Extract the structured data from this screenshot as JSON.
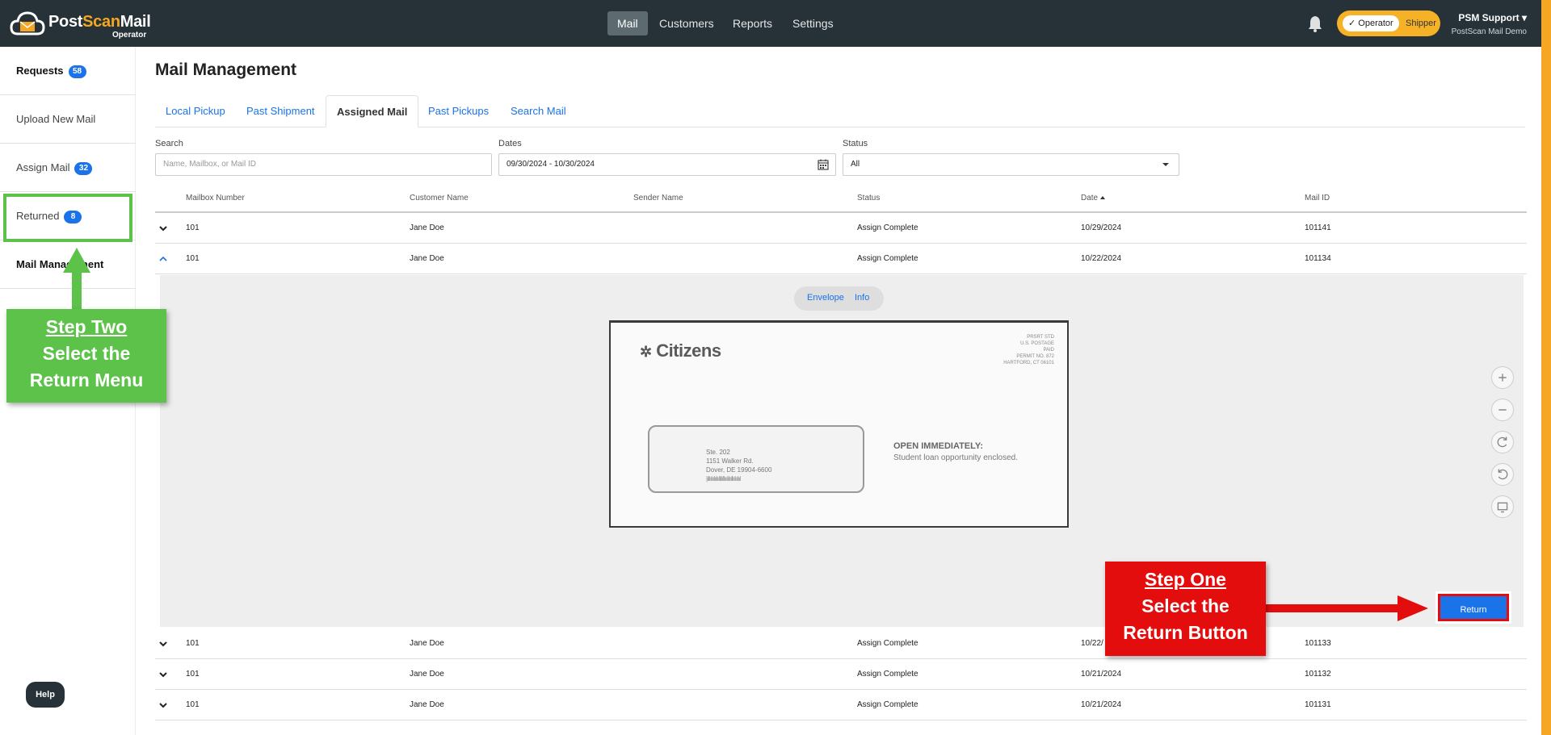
{
  "app": {
    "brand_part1": "Post",
    "brand_part2": "Scan",
    "brand_part3": "Mail",
    "brand_sub": "Operator",
    "nav": [
      "Mail",
      "Customers",
      "Reports",
      "Settings"
    ],
    "active_nav": "Mail",
    "roles": [
      "Operator",
      "Shipper"
    ],
    "user_name": "PSM Support",
    "user_org": "PostScan Mail Demo"
  },
  "sidebar": {
    "items": [
      {
        "label": "Requests",
        "badge": "58"
      },
      {
        "label": "Upload New Mail",
        "badge": ""
      },
      {
        "label": "Assign Mail",
        "badge": "32"
      },
      {
        "label": "Returned",
        "badge": "8"
      },
      {
        "label": "Mail Management",
        "badge": ""
      }
    ],
    "help_label": "Help"
  },
  "page": {
    "title": "Mail Management",
    "tabs": [
      "Local Pickup",
      "Past Shipment",
      "Assigned Mail",
      "Past Pickups",
      "Search Mail"
    ],
    "active_tab": "Assigned Mail"
  },
  "filters": {
    "search_label": "Search",
    "search_placeholder": "Name, Mailbox, or Mail ID",
    "dates_label": "Dates",
    "dates_value": "09/30/2024 - 10/30/2024",
    "status_label": "Status",
    "status_value": "All"
  },
  "table": {
    "columns": [
      "Mailbox Number",
      "Customer Name",
      "Sender Name",
      "Status",
      "Date",
      "Mail ID"
    ],
    "rows": [
      {
        "mailbox": "101",
        "customer": "Jane Doe",
        "sender": "",
        "status": "Assign Complete",
        "date": "10/29/2024",
        "mail_id": "101141",
        "expanded": false
      },
      {
        "mailbox": "101",
        "customer": "Jane Doe",
        "sender": "",
        "status": "Assign Complete",
        "date": "10/22/2024",
        "mail_id": "101134",
        "expanded": true
      },
      {
        "mailbox": "101",
        "customer": "Jane Doe",
        "sender": "",
        "status": "Assign Complete",
        "date": "10/22/",
        "mail_id": "101133",
        "expanded": false
      },
      {
        "mailbox": "101",
        "customer": "Jane Doe",
        "sender": "",
        "status": "Assign Complete",
        "date": "10/21/2024",
        "mail_id": "101132",
        "expanded": false
      },
      {
        "mailbox": "101",
        "customer": "Jane Doe",
        "sender": "",
        "status": "Assign Complete",
        "date": "10/21/2024",
        "mail_id": "101131",
        "expanded": false
      }
    ]
  },
  "detail": {
    "view_options": [
      "Envelope",
      "Info"
    ],
    "envelope": {
      "brand": "Citizens",
      "postage": "PRSRT STD\nU.S. POSTAGE\nPAID\nPERMIT NO. 872\nHARTFORD, CT 06101",
      "address_line1": "Ste. 202",
      "address_line2": "1151 Walker Rd.",
      "address_line3": "Dover, DE 19904-6600",
      "open_title": "OPEN IMMEDIATELY:",
      "open_sub": "Student loan opportunity enclosed."
    },
    "tools": [
      "zoom-in",
      "zoom-out",
      "rotate-right",
      "rotate-left",
      "fullscreen"
    ],
    "return_label": "Return"
  },
  "annotations": {
    "step_two_title": "Step Two",
    "step_two_line1": "Select the",
    "step_two_line2": "Return Menu",
    "step_one_title": "Step One",
    "step_one_line1": "Select the",
    "step_one_line2": "Return Button",
    "green": "#5cc24a",
    "red": "#e30d0d"
  },
  "colors": {
    "topbar": "#263238",
    "accent": "#f5a623",
    "link": "#1a73e8"
  }
}
